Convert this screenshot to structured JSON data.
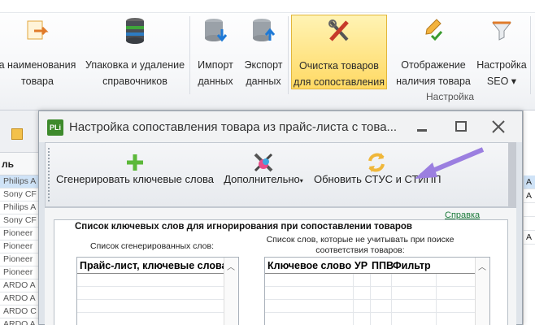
{
  "ribbon": {
    "buttons": [
      {
        "label1": "а наименования",
        "label2": "товара",
        "icon": "copy-arrow-icon"
      },
      {
        "label1": "Упаковка и удаление",
        "label2": "справочников",
        "icon": "database-icon"
      },
      {
        "label1": "Импорт",
        "label2": "данных",
        "icon": "database-import-icon"
      },
      {
        "label1": "Экспорт",
        "label2": "данных",
        "icon": "database-export-icon"
      },
      {
        "label1": "Очистка товаров",
        "label2": "для сопоставления",
        "icon": "tools-icon"
      },
      {
        "label1": "Отображение",
        "label2": "наличия товара",
        "icon": "pencil-check-icon"
      },
      {
        "label1": "Настройка",
        "label2": "SEO ▾",
        "icon": "filter-funnel-icon"
      }
    ],
    "group_caption": "Настройка",
    "accent": "#ffd963"
  },
  "left_grid": {
    "header": "ль",
    "rows": [
      "Philips A",
      "Sony CF",
      "Philips A",
      "Sony CF",
      "Pioneer",
      "Pioneer",
      "Pioneer",
      "Pioneer",
      "ARDO A",
      "ARDO A",
      "ARDO C",
      "ARDO A"
    ]
  },
  "right_grid": {
    "rows": [
      "A",
      "A",
      "",
      "",
      "A"
    ]
  },
  "dialog": {
    "logo": "PLi",
    "title": "Настройка сопоставления товара из прайс-листа с това...",
    "toolbar": {
      "generate_label": "Сгенерировать ключевые слова",
      "extra_label": "Дополнительно",
      "extra_arrow": "▾",
      "update_label": "Обновить СТУС и СТИПП"
    },
    "help_link": "Справка",
    "panel": {
      "title": "Список ключевых слов для игнорирования при сопоставлении товаров",
      "generated_caption": "Список сгенерированных слов:",
      "ignore_caption_line1": "Список слов, которые не учитывать при поиске",
      "ignore_caption_line2": "соответствия товаров:",
      "left_grid_header": "Прайс-лист, ключевые слова",
      "right_grid_headers": [
        "Ключевое слово",
        "УР",
        "ППВ",
        "Фильтр"
      ]
    }
  },
  "colors": {
    "pointer_arrow": "#9b7fe0",
    "help_link": "#1a7a3a"
  }
}
